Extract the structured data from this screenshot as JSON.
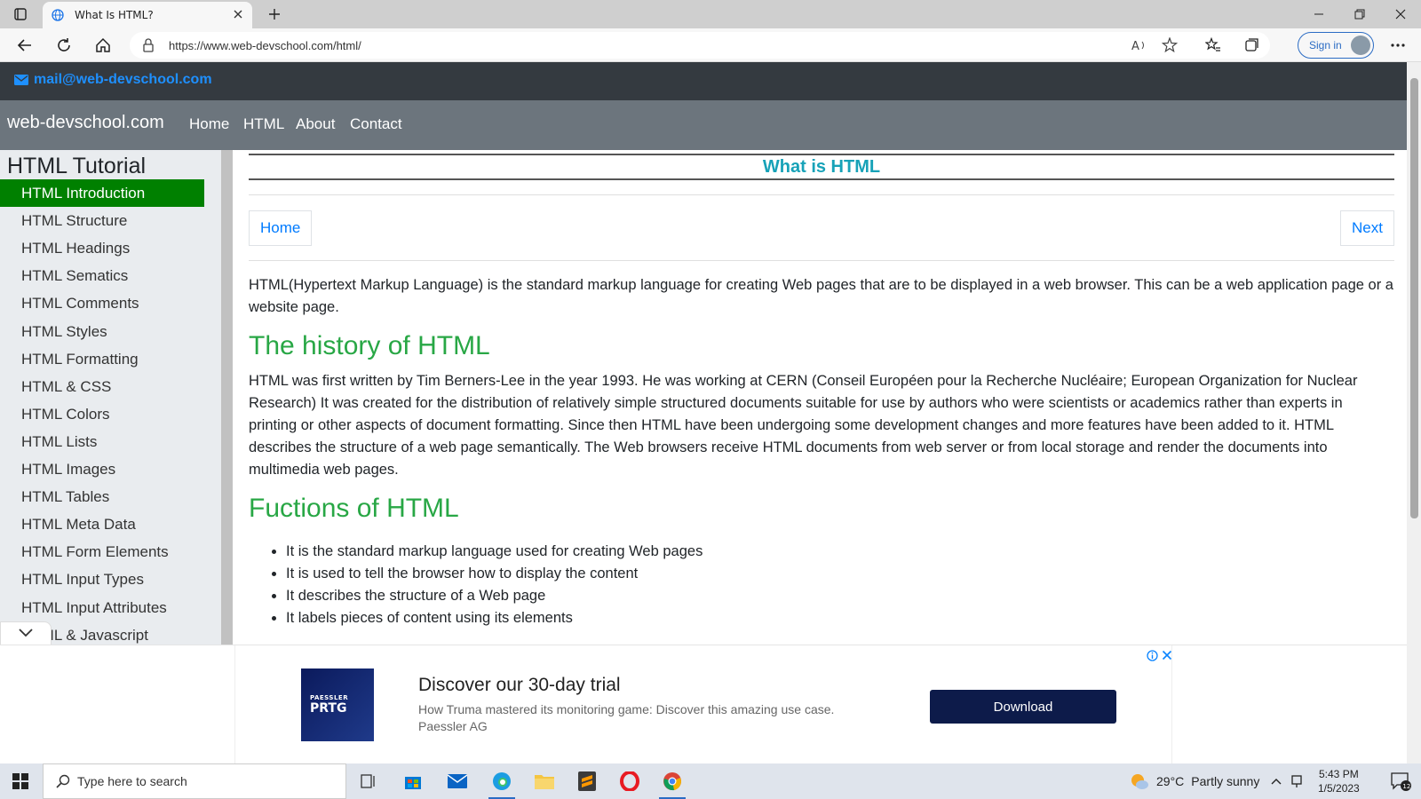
{
  "browser": {
    "tab_title": "What Is HTML?",
    "url": "https://www.web-devschool.com/html/",
    "signin_label": "Sign in"
  },
  "site": {
    "email": "mail@web-devschool.com",
    "brand": "web-devschool.com",
    "nav": [
      "Home",
      "HTML",
      "About",
      "Contact"
    ]
  },
  "sidebar": {
    "title": "HTML Tutorial",
    "items": [
      {
        "label": "HTML Introduction",
        "active": true
      },
      {
        "label": "HTML Structure"
      },
      {
        "label": "HTML Headings"
      },
      {
        "label": "HTML Sematics"
      },
      {
        "label": "HTML Comments"
      },
      {
        "label": "HTML Styles"
      },
      {
        "label": "HTML Formatting"
      },
      {
        "label": "HTML & CSS"
      },
      {
        "label": "HTML Colors"
      },
      {
        "label": "HTML Lists"
      },
      {
        "label": "HTML Images"
      },
      {
        "label": "HTML Tables"
      },
      {
        "label": "HTML Meta Data"
      },
      {
        "label": "HTML Form Elements"
      },
      {
        "label": "HTML Input Types"
      },
      {
        "label": "HTML Input Attributes"
      },
      {
        "label": "HTML & Javascript"
      }
    ]
  },
  "main": {
    "page_title": "What is HTML",
    "home_btn": "Home",
    "next_btn": "Next",
    "intro": "HTML(Hypertext Markup Language) is the standard markup language for creating Web pages that are to be displayed in a web browser. This can be a web application page or a website page.",
    "history_heading": "The history of HTML",
    "history_text": "HTML was first written by Tim Berners-Lee in the year 1993. He was working at CERN (Conseil Européen pour la Recherche Nucléaire; European Organization for Nuclear Research) It was created for the distribution of relatively simple structured documents suitable for use by authors who were scientists or academics rather than experts in printing or other aspects of document formatting. Since then HTML have been undergoing some development changes and more features have been added to it. HTML describes the structure of a web page semantically. The Web browsers receive HTML documents from web server or from local storage and render the documents into multimedia web pages.",
    "functions_heading": "Fuctions of HTML",
    "functions": [
      "It is the standard markup language used for creating Web pages",
      "It is used to tell the browser how to display the content",
      "It describes the structure of a Web page",
      "It labels pieces of content using its elements"
    ]
  },
  "ad": {
    "logo_small": "PAESSLER",
    "logo_big": "PRTG",
    "title": "Discover our 30-day trial",
    "description": "How Truma mastered its monitoring game: Discover this amazing use case.",
    "advertiser": "Paessler AG",
    "button": "Download"
  },
  "taskbar": {
    "search_placeholder": "Type here to search",
    "temperature": "29°C",
    "weather": "Partly sunny",
    "time": "5:43 PM",
    "date": "1/5/2023",
    "notification_count": "12"
  },
  "colors": {
    "active_sidebar": "#008000",
    "section_heading": "#28a745",
    "page_title": "#17a2b8",
    "link": "#007bff"
  }
}
